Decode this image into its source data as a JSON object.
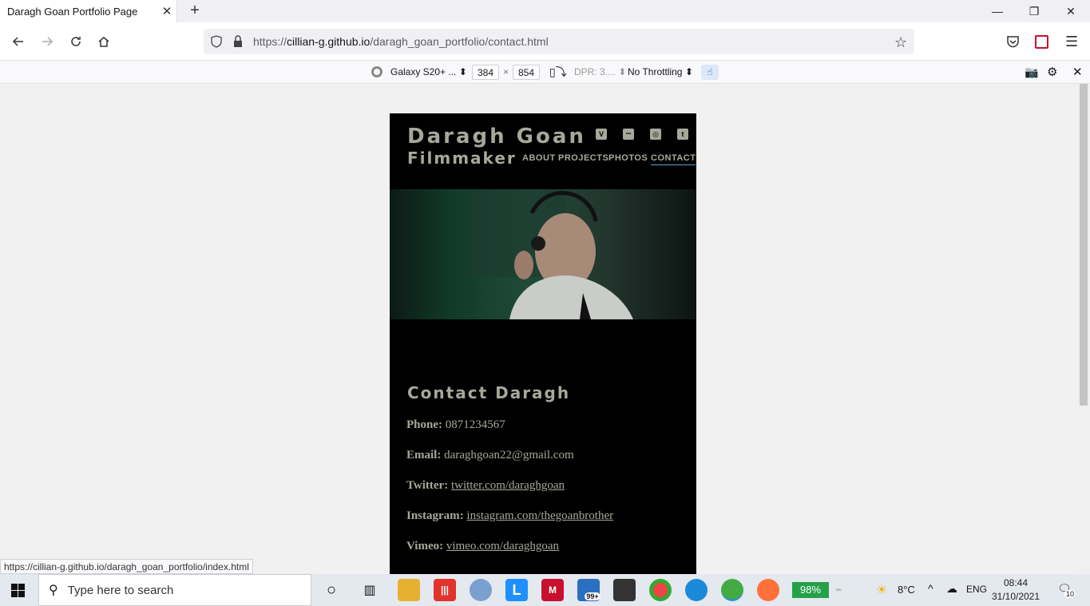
{
  "browser": {
    "tab_title": "Daragh Goan Portfolio Page",
    "tab_close": "✕",
    "new_tab": "+",
    "url_host": "cillian-g.github.io",
    "url_path": "/daragh_goan_portfolio/contact.html",
    "url_scheme": "https://",
    "status_link": "https://cillian-g.github.io/daragh_goan_portfolio/index.html"
  },
  "rdm": {
    "device": "Galaxy S20+ ...",
    "width": "384",
    "times": "×",
    "height": "854",
    "dpr": "DPR: 3....",
    "throttling": "No Throttling"
  },
  "site": {
    "name": "Daragh Goan",
    "subtitle": "Filmmaker",
    "nav": [
      "About",
      "Projects",
      "Photos",
      "Contact"
    ],
    "social": [
      "V",
      "▪▪▪",
      "◎",
      "t"
    ],
    "contact_heading": "Contact Daragh",
    "contacts": [
      {
        "label": "Phone:",
        "value": "0871234567",
        "link": false
      },
      {
        "label": "Email:",
        "value": "daraghgoan22@gmail.com",
        "link": false
      },
      {
        "label": "Twitter:",
        "value": "twitter.com/daraghgoan",
        "link": true
      },
      {
        "label": "Instagram:",
        "value": "instagram.com/thegoanbrother",
        "link": true
      },
      {
        "label": "Vimeo:",
        "value": "vimeo.com/daraghgoan",
        "link": true
      }
    ]
  },
  "taskbar": {
    "search_placeholder": "Type here to search",
    "battery": "98%",
    "temp": "8°C",
    "lang": "ENG",
    "time": "08:44",
    "date": "31/10/2021",
    "mail_badge": "99+",
    "notif_count": "10"
  }
}
